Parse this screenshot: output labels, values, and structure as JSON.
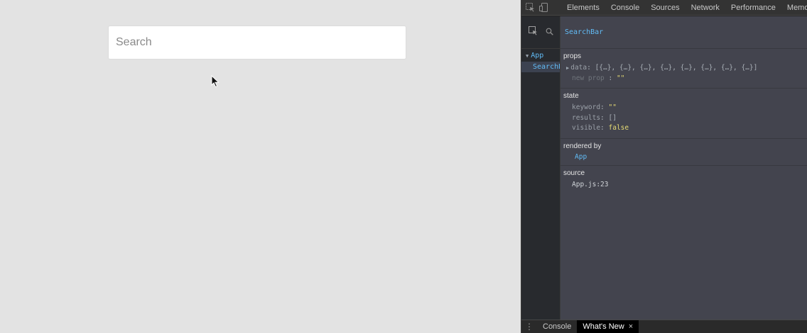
{
  "app": {
    "search_placeholder": "Search",
    "search_value": ""
  },
  "devtools": {
    "tabs": [
      "Elements",
      "Console",
      "Sources",
      "Network",
      "Performance",
      "Memory"
    ],
    "bottom_tabs": {
      "console": "Console",
      "whats_new": "What's New",
      "close": "×"
    },
    "tree": {
      "app": "App",
      "searchbar": "SearchB"
    },
    "selected_component": "SearchBar",
    "props": {
      "title": "props",
      "data_key": "data",
      "data_value": "[{…}, {…}, {…}, {…}, {…}, {…}, {…}, {…}]",
      "new_prop_key": "new prop",
      "new_prop_value": "\"\""
    },
    "state": {
      "title": "state",
      "keyword_key": "keyword",
      "keyword_value": "\"\"",
      "results_key": "results",
      "results_value": "[]",
      "visible_key": "visible",
      "visible_value": "false"
    },
    "rendered_by": {
      "title": "rendered by",
      "value": "App"
    },
    "source": {
      "title": "source",
      "value": "App.js:23"
    }
  },
  "colors": {
    "page_bg": "#e3e3e3",
    "devtools_panel": "#43444e",
    "component_blue": "#62bcf6",
    "value_yellow": "#e6db74"
  },
  "icons": [
    "inspect-icon",
    "device-toggle-icon",
    "select-element-icon",
    "search-icon",
    "caret-down-icon",
    "caret-right-icon",
    "kebab-menu-icon",
    "mouse-cursor-icon"
  ]
}
